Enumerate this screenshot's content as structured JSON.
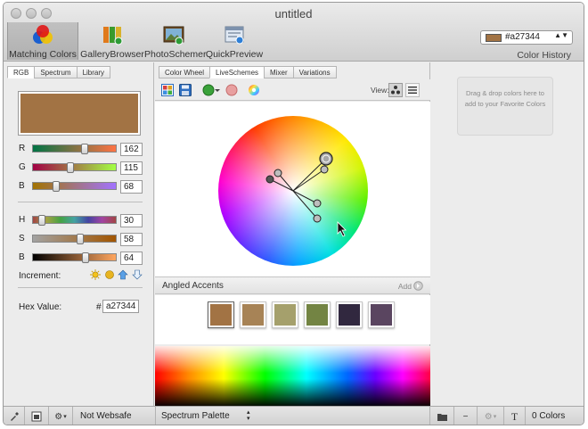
{
  "window": {
    "title": "untitled"
  },
  "toolbar": {
    "items": [
      {
        "label": "Matching Colors",
        "icon": "matching-colors-icon"
      },
      {
        "label": "GalleryBrowser",
        "icon": "gallery-browser-icon"
      },
      {
        "label": "PhotoSchemer",
        "icon": "photo-schemer-icon"
      },
      {
        "label": "QuickPreview",
        "icon": "quick-preview-icon"
      }
    ],
    "history_swatch_hex": "#a27344",
    "history_label": "Color History"
  },
  "left_panel": {
    "tabs": [
      "RGB",
      "Spectrum",
      "Library"
    ],
    "current_color": "#a27344",
    "rgb": [
      {
        "label": "R",
        "value": "162",
        "fraction": 0.635
      },
      {
        "label": "G",
        "value": "115",
        "fraction": 0.451
      },
      {
        "label": "B",
        "value": "68",
        "fraction": 0.267
      }
    ],
    "hsb": [
      {
        "label": "H",
        "value": "30",
        "fraction": 0.083
      },
      {
        "label": "S",
        "value": "58",
        "fraction": 0.58
      },
      {
        "label": "B",
        "value": "64",
        "fraction": 0.64
      }
    ],
    "increment_label": "Increment:",
    "hex_label": "Hex Value:",
    "hash": "#",
    "hex_value": "a27344"
  },
  "middle_panel": {
    "tabs": [
      "Color Wheel",
      "LiveSchemes",
      "Mixer",
      "Variations"
    ],
    "view_label": "View:",
    "scheme_name": "Angled Accents",
    "add_label": "Add",
    "scheme_swatches": [
      "#a27344",
      "#a78356",
      "#a5a06c",
      "#738443",
      "#31283f",
      "#5a4560"
    ],
    "palette_label": "Spectrum Palette"
  },
  "right_panel": {
    "drop_hint": "Drag & drop colors here to add to your Favorite Colors"
  },
  "bottom_bar": {
    "websafe_label": "Not Websafe",
    "colors_count": "0 Colors"
  },
  "colors": {
    "accent": "#a27344"
  }
}
